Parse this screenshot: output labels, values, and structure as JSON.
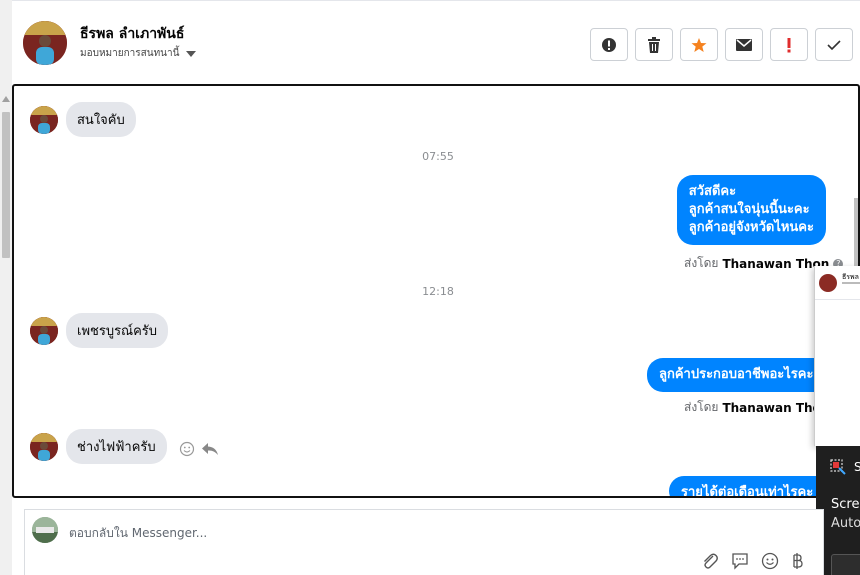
{
  "header": {
    "contact_name": "ธีรพล ลำเภาพันธ์",
    "assign_label": "มอบหมายการสนทนานี้",
    "actions": [
      "mark-spam",
      "delete",
      "star",
      "mark-unread",
      "important",
      "done"
    ]
  },
  "conversation": {
    "messages": [
      {
        "direction": "in",
        "text": "สนใจคับ"
      },
      {
        "type": "timestamp",
        "text": "07:55"
      },
      {
        "direction": "out",
        "lines": [
          "สวัสดีคะ",
          "ลูกค้าสนใจนุ่นนี้นะคะ",
          "ลูกค้าอยู่จังหวัดไหนคะ"
        ]
      },
      {
        "type": "sent_by",
        "prefix": "ส่งโดย",
        "name": "Thanawan Thon"
      },
      {
        "type": "timestamp",
        "text": "12:18"
      },
      {
        "direction": "in",
        "text": "เพชรบูรณ์ครับ"
      },
      {
        "direction": "out",
        "text": "ลูกค้าประกอบอาชีพอะไรคะ"
      },
      {
        "type": "sent_by",
        "prefix": "ส่งโดย",
        "name": "Thanawan Thon"
      },
      {
        "direction": "in",
        "text": "ช่างไฟฟ้าครับ"
      },
      {
        "direction": "out",
        "text": "รายได้ต่อเดือนเท่าไรคะ"
      }
    ]
  },
  "popup": {
    "name": "ธีรพล"
  },
  "toast": {
    "title": "S",
    "line1": "Scree",
    "line2": "Auto"
  },
  "composer": {
    "placeholder": "ตอบกลับใน Messenger...",
    "tools": [
      "attachment-icon",
      "saved-reply-icon",
      "emoji-icon",
      "baht-icon"
    ]
  },
  "colors": {
    "outgoing_bubble": "#0084ff",
    "incoming_bubble": "#e4e6eb",
    "star": "#f5821f",
    "important": "#e02d2d"
  }
}
